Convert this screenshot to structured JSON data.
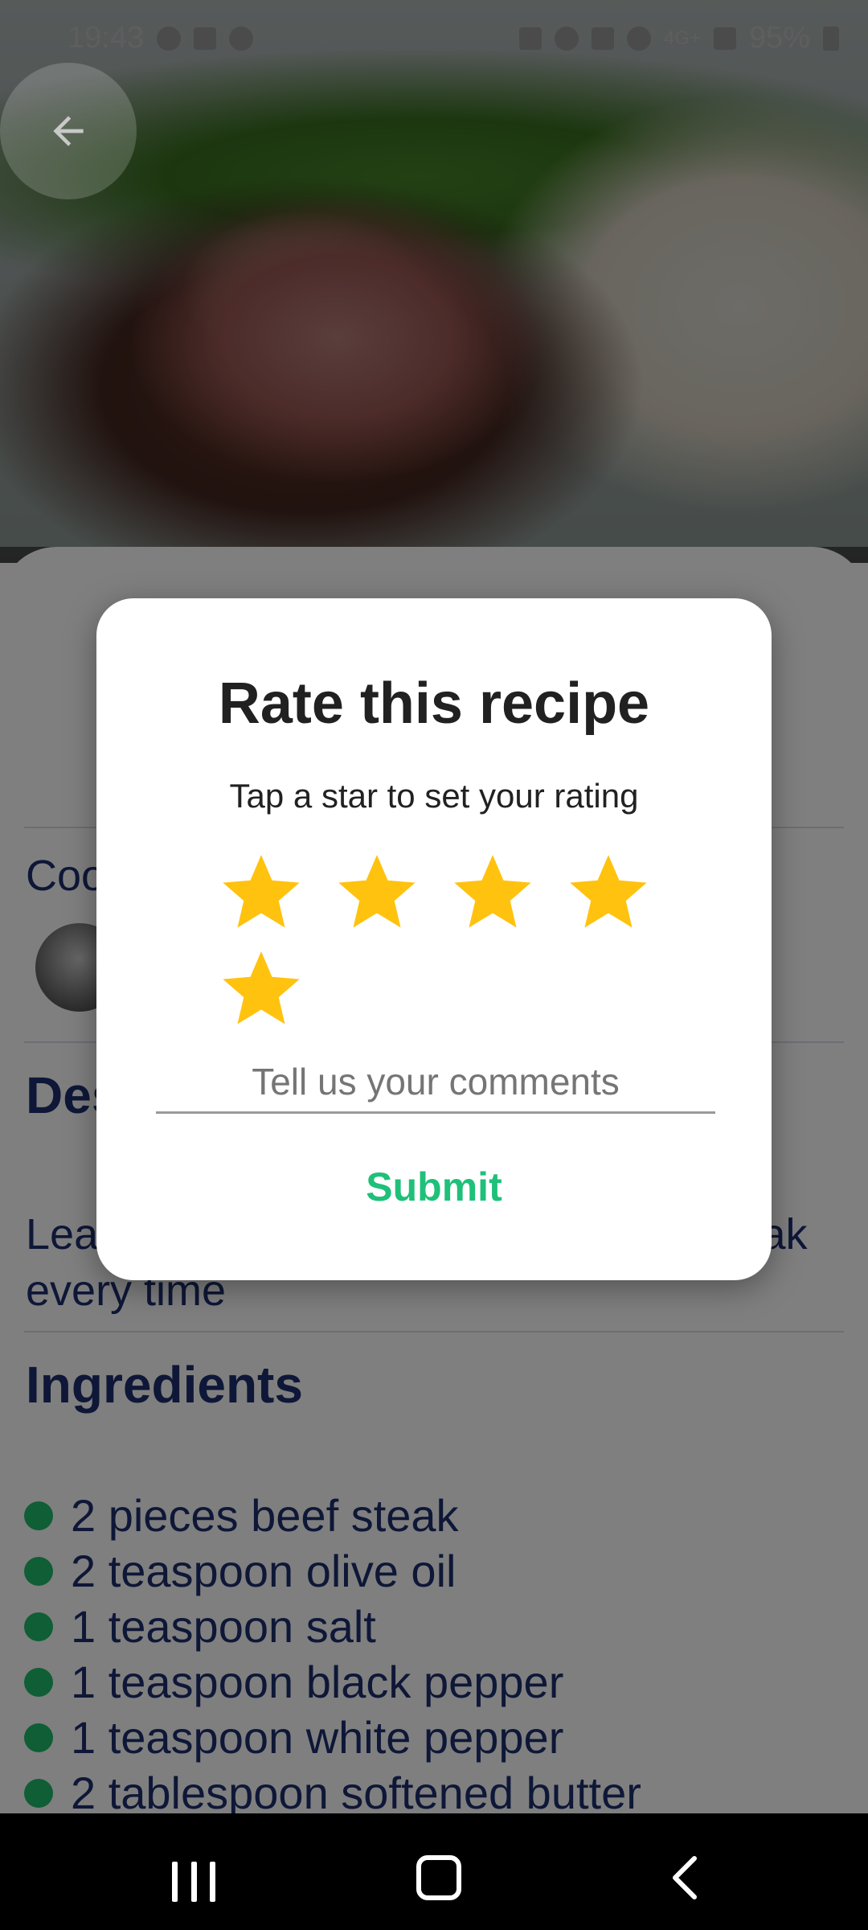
{
  "status_bar": {
    "time": "19:43",
    "signal": "4G+",
    "battery": "95%"
  },
  "page": {
    "sections": {
      "cook_label": "Cook",
      "description_title": "Description",
      "description_text": "Learn how to cook a perfectly juicy steak every time",
      "ingredients_title": "Ingredients"
    },
    "ingredients": [
      "2 pieces beef steak",
      "2 teaspoon olive oil",
      "1 teaspoon salt",
      "1 teaspoon black pepper",
      "1 teaspoon white pepper",
      "2 tablespoon softened butter"
    ],
    "colors": {
      "title": "#1d2e6f",
      "bullet": "#1fbd6a"
    }
  },
  "dialog": {
    "title": "Rate this recipe",
    "subtitle": "Tap a star to set your rating",
    "rating": 5,
    "max_rating": 5,
    "comment_placeholder": "Tell us your comments",
    "comment_value": "",
    "submit_label": "Submit",
    "colors": {
      "star": "#ffc20e",
      "submit": "#1fc07a"
    }
  },
  "icons": {
    "back": "arrow-left-icon",
    "star": "star-icon",
    "nav_recents": "recents-icon",
    "nav_home": "home-icon",
    "nav_back": "chevron-left-icon"
  }
}
